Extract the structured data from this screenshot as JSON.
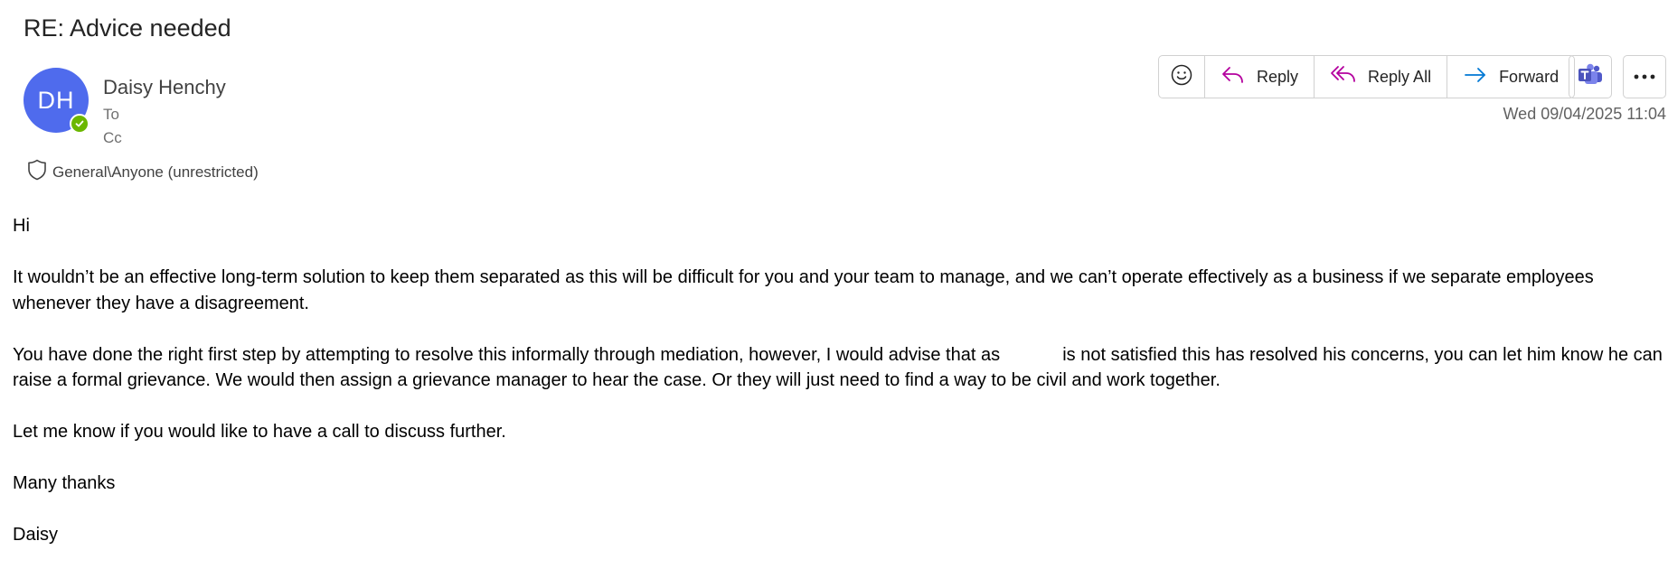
{
  "email": {
    "subject": "RE: Advice needed",
    "sender": {
      "initials": "DH",
      "name": "Daisy Henchy",
      "avatar_color": "#4f6bed",
      "presence": "available",
      "presence_color": "#6bb700"
    },
    "to_label": "To",
    "cc_label": "Cc",
    "sensitivity_label": "General\\Anyone (unrestricted)",
    "timestamp": "Wed 09/04/2025 11:04",
    "actions": {
      "emoji_icon": "smiley-icon",
      "reply": "Reply",
      "reply_all": "Reply All",
      "forward": "Forward",
      "teams_icon": "teams-icon",
      "more_icon": "more-icon"
    },
    "body": {
      "greeting": "Hi",
      "paragraph1": "It wouldn’t be an effective long-term solution to keep them separated as this will be difficult for you and your team to manage, and we can’t operate effectively as a business if we separate employees whenever they have a disagreement.",
      "paragraph2_part1": "You have done the right first step by attempting to resolve this informally through mediation, however, I would advise that as",
      "paragraph2_part2": "is not satisfied this has resolved his concerns, you can let him know he can raise a formal grievance. We would then assign a grievance manager to hear the case. Or they will just need to find a way to be civil and work together.",
      "paragraph3": "Let me know if you would like to have a call to discuss further.",
      "signoff": "Many thanks",
      "signature": "Daisy"
    }
  },
  "colors": {
    "reply_icon": "#b4009e",
    "forward_icon": "#0078d4",
    "teams": "#5059c9"
  }
}
